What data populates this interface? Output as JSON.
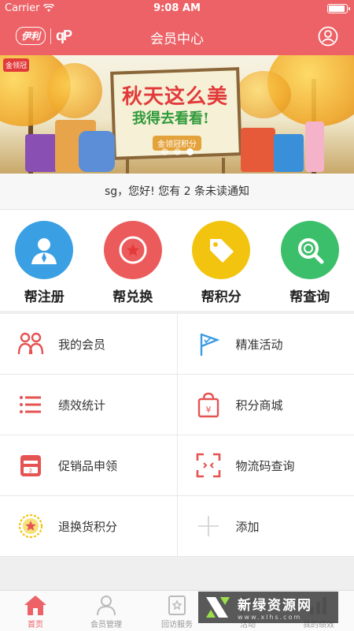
{
  "status": {
    "carrier": "Carrier",
    "time": "9:08 AM"
  },
  "nav": {
    "title": "会员中心",
    "logo_text": "伊利",
    "logo_mark": "qP"
  },
  "banner": {
    "headline": "秋天这么美",
    "subline": "我得去看看!",
    "tag": "金领冠积分",
    "brand": "金领冠",
    "dots": 3,
    "active_dot": 2
  },
  "notice": {
    "text": "sg，您好! 您有 2 条未读通知"
  },
  "quick_actions": [
    {
      "label": "帮注册",
      "color": "#3aa0e3",
      "icon": "person-icon"
    },
    {
      "label": "帮兑换",
      "color": "#ec5b5b",
      "icon": "star-icon"
    },
    {
      "label": "帮积分",
      "color": "#f2c40f",
      "icon": "tag-icon"
    },
    {
      "label": "帮查询",
      "color": "#3cbf6a",
      "icon": "magnifier-icon"
    }
  ],
  "menu": [
    {
      "left": {
        "label": "我的会员",
        "icon": "members-icon"
      },
      "right": {
        "label": "精准活动",
        "icon": "flag-icon"
      }
    },
    {
      "left": {
        "label": "绩效统计",
        "icon": "list-icon"
      },
      "right": {
        "label": "积分商城",
        "icon": "shopping-bag-icon"
      }
    },
    {
      "left": {
        "label": "促销品申领",
        "icon": "coupon-icon"
      },
      "right": {
        "label": "物流码查询",
        "icon": "scan-icon"
      }
    },
    {
      "left": {
        "label": "退换货积分",
        "icon": "star-badge-icon"
      },
      "right": {
        "label": "添加",
        "icon": "plus-icon"
      }
    }
  ],
  "tabs": [
    {
      "label": "首页",
      "icon": "home-icon",
      "active": true
    },
    {
      "label": "会员管理",
      "icon": "member-manage-icon",
      "active": false
    },
    {
      "label": "回访服务",
      "icon": "visit-service-icon",
      "active": false
    },
    {
      "label": "活动",
      "icon": "activity-icon",
      "active": false
    },
    {
      "label": "我的绩效",
      "icon": "performance-icon",
      "active": false
    }
  ],
  "watermark": {
    "main": "新绿资源网",
    "sub": "www.xlhs.com"
  },
  "colors": {
    "primary": "#ec6266",
    "accent_red": "#e23a3a",
    "tab_inactive": "#999999"
  }
}
